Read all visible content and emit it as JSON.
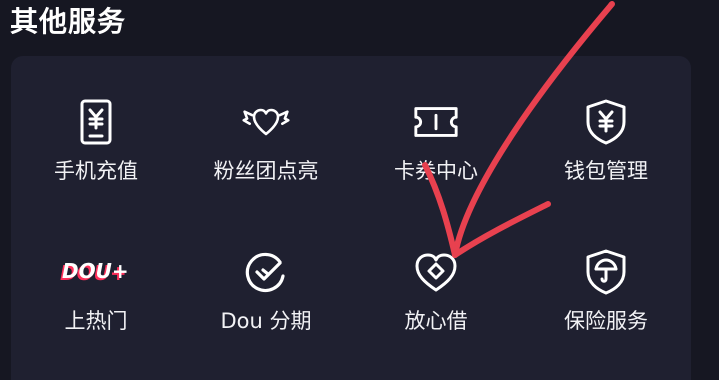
{
  "section": {
    "title": "其他服务"
  },
  "services": [
    {
      "label": "手机充值",
      "icon": "phone-recharge-icon"
    },
    {
      "label": "粉丝团点亮",
      "icon": "winged-heart-icon"
    },
    {
      "label": "卡券中心",
      "icon": "ticket-icon"
    },
    {
      "label": "钱包管理",
      "icon": "shield-yen-icon"
    },
    {
      "label": "上热门",
      "icon": "dou-plus-logo",
      "logo_text": "DOU+"
    },
    {
      "label": "Dou 分期",
      "icon": "check-circle-icon"
    },
    {
      "label": "放心借",
      "icon": "heart-diamond-icon"
    },
    {
      "label": "保险服务",
      "icon": "shield-umbrella-icon"
    }
  ],
  "colors": {
    "background": "#161722",
    "card": "#1f2030",
    "text": "#f2f2f5",
    "annotation": "#e8414f"
  }
}
